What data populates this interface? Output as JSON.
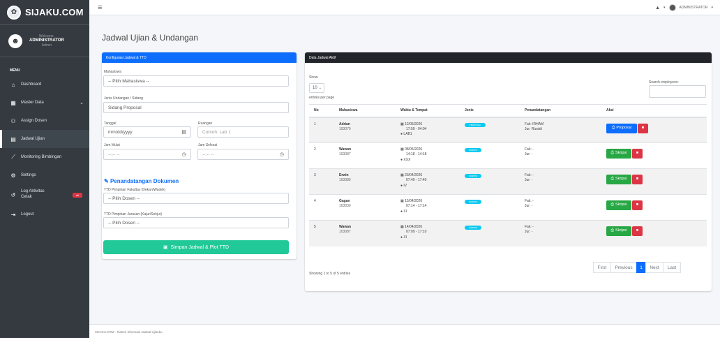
{
  "brand": {
    "name": "SIJAKU.COM"
  },
  "user": {
    "welcome": "Welcome,",
    "name": "ADMINISTRATOR",
    "role": "Admin"
  },
  "sidebar": {
    "header": "MENU",
    "items": [
      {
        "label": "Dashboard"
      },
      {
        "label": "Master Data"
      },
      {
        "label": "Assign Dosen"
      },
      {
        "label": "Jadwal Ujian"
      },
      {
        "label": "Monitoring Bimbingan"
      },
      {
        "label": "Settings"
      },
      {
        "label": "Log Aktivitas",
        "label2": "Cetak",
        "badge": "all"
      },
      {
        "label": "Logout"
      }
    ]
  },
  "topbar": {
    "admin_label": "ADMINISTRATOR"
  },
  "page": {
    "title": "Jadwal Ujian & Undangan"
  },
  "form": {
    "card_title": "Konfigurasi Jadwal & TTD",
    "mahasiswa_label": "Mahasiswa",
    "mahasiswa_value": "-- Pilih Mahasiswa --",
    "jenis_label": "Jenis Undangan / Sidang",
    "jenis_value": "Sidang Proposal",
    "tanggal_label": "Tanggal",
    "tanggal_placeholder": "mm/dd/yyyy",
    "ruangan_label": "Ruangan",
    "ruangan_placeholder": "Contoh: Lab 1",
    "jam_mulai_label": "Jam Mulai",
    "jam_mulai_placeholder": "--:-- --",
    "jam_selesai_label": "Jam Selesai",
    "jam_selesai_placeholder": "--:-- --",
    "section_title": "Penandatangan Dokumen",
    "ttd_fakultas_label": "TTD Pimpinan Fakultas (Dekan/Wadek)",
    "ttd_fakultas_value": "-- Pilih Dosen --",
    "ttd_jurusan_label": "TTD Pimpinan Jurusan (Kajur/Sekjur)",
    "ttd_jurusan_value": "-- Pilih Dosen --",
    "save_label": "Simpan Jadwal & Plot TTD"
  },
  "table": {
    "card_title": "Data Jadwal Aktif",
    "show_label": "Show",
    "show_value": "10",
    "entries_label": "entries per page",
    "search_label": "Search employees:",
    "headers": [
      "No",
      "Mahasiswa",
      "Waktu & Tempat",
      "Jenis",
      "Penandatangan",
      "Aksi"
    ],
    "rows": [
      {
        "no": "1",
        "name": "Adrian",
        "nim": "103070",
        "date": "12/05/2026",
        "time": "17:59 - 04:04",
        "place": "LAB1",
        "jenis": "PROPOSAL",
        "fak": "Fak: IRHAM",
        "jur": "Jur: Rizaldi",
        "action": "Proposal"
      },
      {
        "no": "2",
        "name": "Wawan",
        "nim": "103087",
        "date": "08/05/2026",
        "time": "14:18 - 14:18",
        "place": "XXX",
        "jenis": "SKRIPSI",
        "fak": "Fak: -",
        "jur": "Jur: -",
        "action": "Skripsi"
      },
      {
        "no": "3",
        "name": "Erwin",
        "nim": "103089",
        "date": "23/04/2026",
        "time": "07:40 - 17:40",
        "place": "IV",
        "jenis": "SKRIPSI",
        "fak": "Fak: -",
        "jur": "Jur: -",
        "action": "Skripsi"
      },
      {
        "no": "4",
        "name": "Gagan",
        "nim": "103030",
        "date": "15/04/2026",
        "time": "07:14 - 17:14",
        "place": "XI",
        "jenis": "SKRIPSI",
        "fak": "Fak: -",
        "jur": "Jur: -",
        "action": "Skripsi"
      },
      {
        "no": "5",
        "name": "Wawan",
        "nim": "103087",
        "date": "14/04/2026",
        "time": "07:09 - 17:10",
        "place": "XI",
        "jenis": "SKRIPSI",
        "fak": "Fak: -",
        "jur": "Jur: -",
        "action": "Skripsi"
      }
    ],
    "info": "Showing 1 to 5 of 5 entries",
    "pager": {
      "first": "First",
      "previous": "Previous",
      "current": "1",
      "next": "Next",
      "last": "Last"
    }
  },
  "footer": {
    "text": "SIJAKU.COM - Sistem Informasi Jadwal Ujianku"
  },
  "colors": {
    "sidebar": "#343a40",
    "primary": "#0d6efd",
    "success": "#20c997",
    "danger": "#dc3545",
    "info": "#0dcaf0",
    "dark": "#212529"
  }
}
